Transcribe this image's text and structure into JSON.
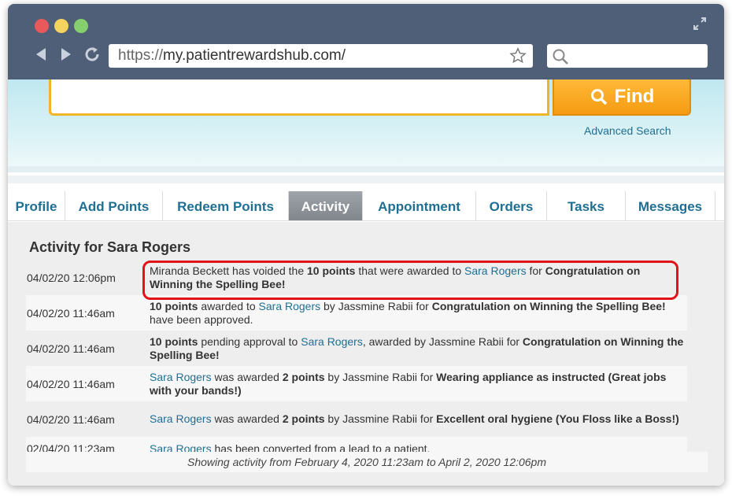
{
  "browser": {
    "url_protocol": "https://",
    "url_host": "my.patientrewardshub.com/"
  },
  "hero": {
    "find_label": "Find",
    "advanced_search": "Advanced Search"
  },
  "tabs": [
    {
      "label": "Profile",
      "active": false
    },
    {
      "label": "Add Points",
      "active": false
    },
    {
      "label": "Redeem Points",
      "active": false
    },
    {
      "label": "Activity",
      "active": true
    },
    {
      "label": "Appointment",
      "active": false
    },
    {
      "label": "Orders",
      "active": false
    },
    {
      "label": "Tasks",
      "active": false
    },
    {
      "label": "Messages",
      "active": false
    }
  ],
  "activity": {
    "title": "Activity for Sara Rogers",
    "rows": [
      {
        "date": "04/02/20 12:06pm",
        "parts": [
          [
            "t",
            "Miranda Beckett has voided the "
          ],
          [
            "b",
            "10 points"
          ],
          [
            "t",
            " that were awarded to "
          ],
          [
            "l",
            "Sara Rogers"
          ],
          [
            "t",
            " for "
          ],
          [
            "b",
            "Congratulation on Winning the Spelling Bee!"
          ]
        ]
      },
      {
        "date": "04/02/20 11:46am",
        "parts": [
          [
            "b",
            "10 points"
          ],
          [
            "t",
            " awarded to "
          ],
          [
            "l",
            "Sara Rogers"
          ],
          [
            "t",
            " by Jassmine Rabii for "
          ],
          [
            "b",
            "Congratulation on Winning the Spelling Bee!"
          ],
          [
            "t",
            " have been approved."
          ]
        ]
      },
      {
        "date": "04/02/20 11:46am",
        "parts": [
          [
            "b",
            "10 points"
          ],
          [
            "t",
            " pending approval to "
          ],
          [
            "l",
            "Sara Rogers"
          ],
          [
            "t",
            ", awarded by Jassmine Rabii for "
          ],
          [
            "b",
            "Congratulation on Winning the Spelling Bee!"
          ]
        ]
      },
      {
        "date": "04/02/20 11:46am",
        "parts": [
          [
            "l",
            "Sara Rogers"
          ],
          [
            "t",
            " was awarded "
          ],
          [
            "b",
            "2 points"
          ],
          [
            "t",
            " by Jassmine Rabii for "
          ],
          [
            "b",
            "Wearing appliance as instructed (Great jobs with your bands!)"
          ]
        ]
      },
      {
        "date": "04/02/20 11:46am",
        "parts": [
          [
            "l",
            "Sara Rogers"
          ],
          [
            "t",
            " was awarded "
          ],
          [
            "b",
            "2 points"
          ],
          [
            "t",
            " by Jassmine Rabii for "
          ],
          [
            "b",
            "Excellent oral hygiene (You Floss like a Boss!)"
          ]
        ]
      },
      {
        "date": "02/04/20 11:23am",
        "parts": [
          [
            "l",
            "Sara Rogers"
          ],
          [
            "t",
            " has been converted from a lead to a patient."
          ]
        ]
      }
    ],
    "footer": "Showing activity from February 4, 2020 11:23am to April 2, 2020 12:06pm"
  },
  "colors": {
    "link": "#1f6f93",
    "highlight": "#e0121a",
    "find_button": "#f59b12"
  }
}
